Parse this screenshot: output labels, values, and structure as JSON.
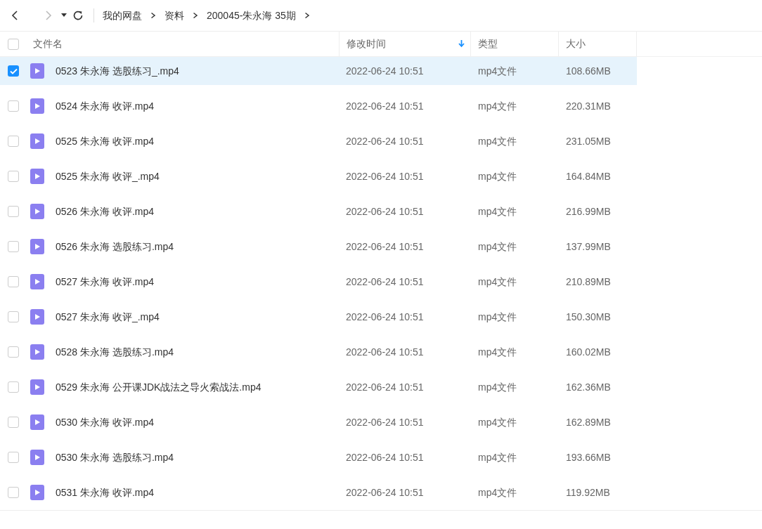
{
  "breadcrumb": [
    {
      "label": "我的网盘"
    },
    {
      "label": "资料"
    },
    {
      "label": "200045-朱永海 35期"
    }
  ],
  "table": {
    "columns": [
      {
        "label": "文件名",
        "sorted": false
      },
      {
        "label": "修改时间",
        "sorted": true
      },
      {
        "label": "类型",
        "sorted": false
      },
      {
        "label": "大小",
        "sorted": false
      }
    ],
    "all_checked": false,
    "rows": [
      {
        "name": "0523 朱永海 选股练习_.mp4",
        "modified": "2022-06-24 10:51",
        "type": "mp4文件",
        "size": "108.66MB",
        "selected": true
      },
      {
        "name": "0524 朱永海 收评.mp4",
        "modified": "2022-06-24 10:51",
        "type": "mp4文件",
        "size": "220.31MB",
        "selected": false
      },
      {
        "name": "0525 朱永海 收评.mp4",
        "modified": "2022-06-24 10:51",
        "type": "mp4文件",
        "size": "231.05MB",
        "selected": false
      },
      {
        "name": "0525 朱永海 收评_.mp4",
        "modified": "2022-06-24 10:51",
        "type": "mp4文件",
        "size": "164.84MB",
        "selected": false
      },
      {
        "name": "0526 朱永海 收评.mp4",
        "modified": "2022-06-24 10:51",
        "type": "mp4文件",
        "size": "216.99MB",
        "selected": false
      },
      {
        "name": "0526 朱永海 选股练习.mp4",
        "modified": "2022-06-24 10:51",
        "type": "mp4文件",
        "size": "137.99MB",
        "selected": false
      },
      {
        "name": "0527 朱永海 收评.mp4",
        "modified": "2022-06-24 10:51",
        "type": "mp4文件",
        "size": "210.89MB",
        "selected": false
      },
      {
        "name": "0527 朱永海 收评_.mp4",
        "modified": "2022-06-24 10:51",
        "type": "mp4文件",
        "size": "150.30MB",
        "selected": false
      },
      {
        "name": "0528 朱永海 选股练习.mp4",
        "modified": "2022-06-24 10:51",
        "type": "mp4文件",
        "size": "160.02MB",
        "selected": false
      },
      {
        "name": "0529 朱永海 公开课JDK战法之导火索战法.mp4",
        "modified": "2022-06-24 10:51",
        "type": "mp4文件",
        "size": "162.36MB",
        "selected": false
      },
      {
        "name": "0530 朱永海 收评.mp4",
        "modified": "2022-06-24 10:51",
        "type": "mp4文件",
        "size": "162.89MB",
        "selected": false
      },
      {
        "name": "0530 朱永海 选股练习.mp4",
        "modified": "2022-06-24 10:51",
        "type": "mp4文件",
        "size": "193.66MB",
        "selected": false
      },
      {
        "name": "0531 朱永海 收评.mp4",
        "modified": "2022-06-24 10:51",
        "type": "mp4文件",
        "size": "119.92MB",
        "selected": false
      }
    ]
  }
}
